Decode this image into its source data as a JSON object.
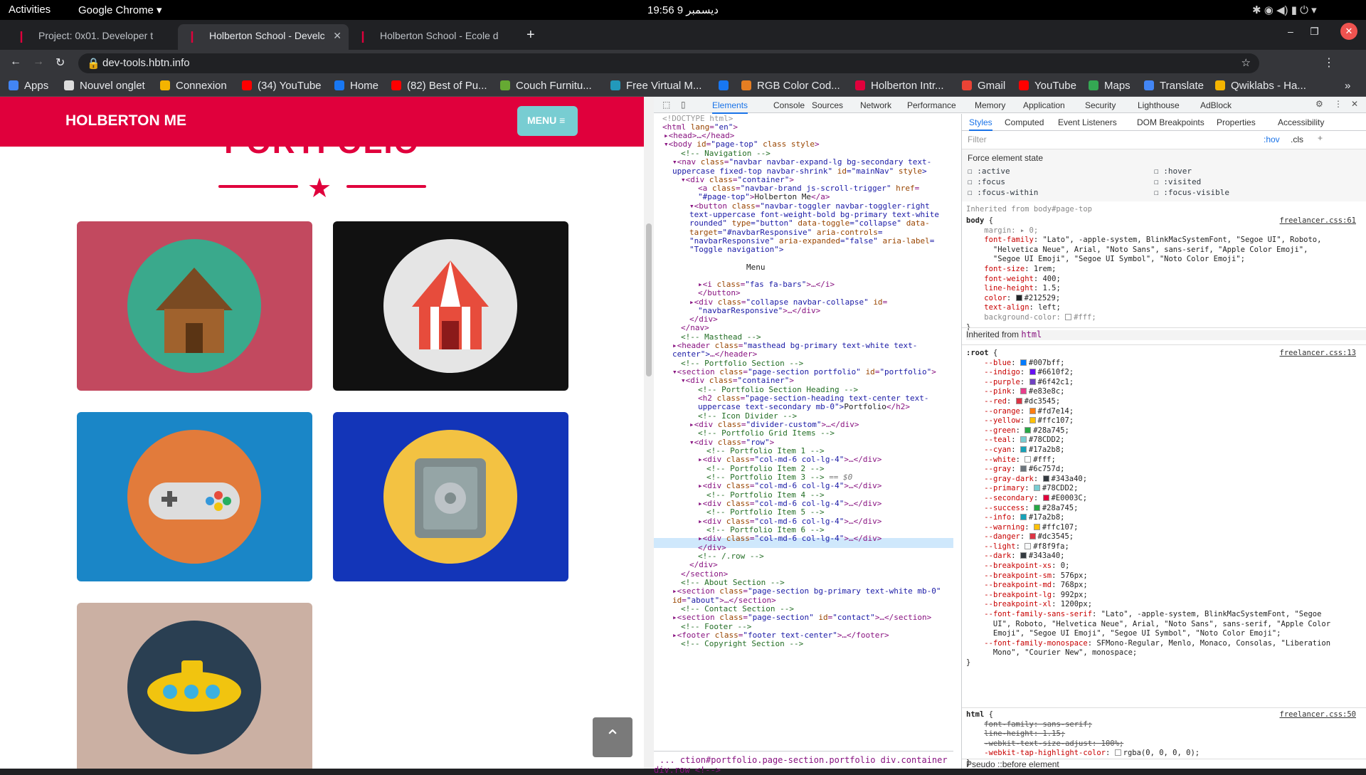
{
  "system": {
    "activities": "Activities",
    "app": "Google Chrome ▾",
    "clock": "19:56 ديسمبر 9"
  },
  "tabs": [
    {
      "label": "Project: 0x01. Developer t"
    },
    {
      "label": "Holberton School - Develc"
    },
    {
      "label": "Holberton School - Ecole d"
    }
  ],
  "address": {
    "url": "dev-tools.hbtn.info"
  },
  "bookmarks": [
    "Apps",
    "Nouvel onglet",
    "Connexion",
    "(34) YouTube",
    "Home",
    "(82) Best of Pu...",
    "Couch Furnitu...",
    "Free Virtual M...",
    "",
    "RGB Color Cod...",
    "Holberton Intr...",
    "Gmail",
    "YouTube",
    "Maps",
    "Translate",
    "Qwiklabs - Ha..."
  ],
  "site": {
    "brand": "HOLBERTON ME",
    "menu": "MENU ≡",
    "title": "PORTFOLIO",
    "scroll_top": "⌃",
    "portfolio_items": [
      {
        "bg": "#c2495f",
        "circle": "#3aa98c",
        "icon": "cabin-icon"
      },
      {
        "bg": "#111111",
        "circle": "#e5e5e5",
        "icon": "circus-tent-icon"
      },
      {
        "bg": "#1a86c7",
        "circle": "#e27b3b",
        "icon": "game-controller-icon"
      },
      {
        "bg": "#1335b8",
        "circle": "#f3c242",
        "icon": "safe-icon"
      },
      {
        "bg": "#cbb0a3",
        "circle": "#2a3f52",
        "icon": "submarine-icon"
      }
    ]
  },
  "devtools": {
    "tabs": [
      "Elements",
      "Console",
      "Sources",
      "Network",
      "Performance",
      "Memory",
      "Application",
      "Security",
      "Lighthouse",
      "AdBlock"
    ],
    "styles_tabs": [
      "Styles",
      "Computed",
      "Event Listeners",
      "DOM Breakpoints",
      "Properties",
      "Accessibility"
    ],
    "filter": "Filter",
    "hov": ":hov",
    ".cls": ".cls",
    "force_title": "Force element state",
    "states": [
      ":active",
      ":hover",
      ":focus",
      ":visited",
      ":focus-within",
      ":focus-visible"
    ],
    "breadcrumbs": "...  ction#portfolio.page-section.portfolio   div.container   div.row   <!-->",
    "pseudo": "Pseudo ::before element"
  }
}
